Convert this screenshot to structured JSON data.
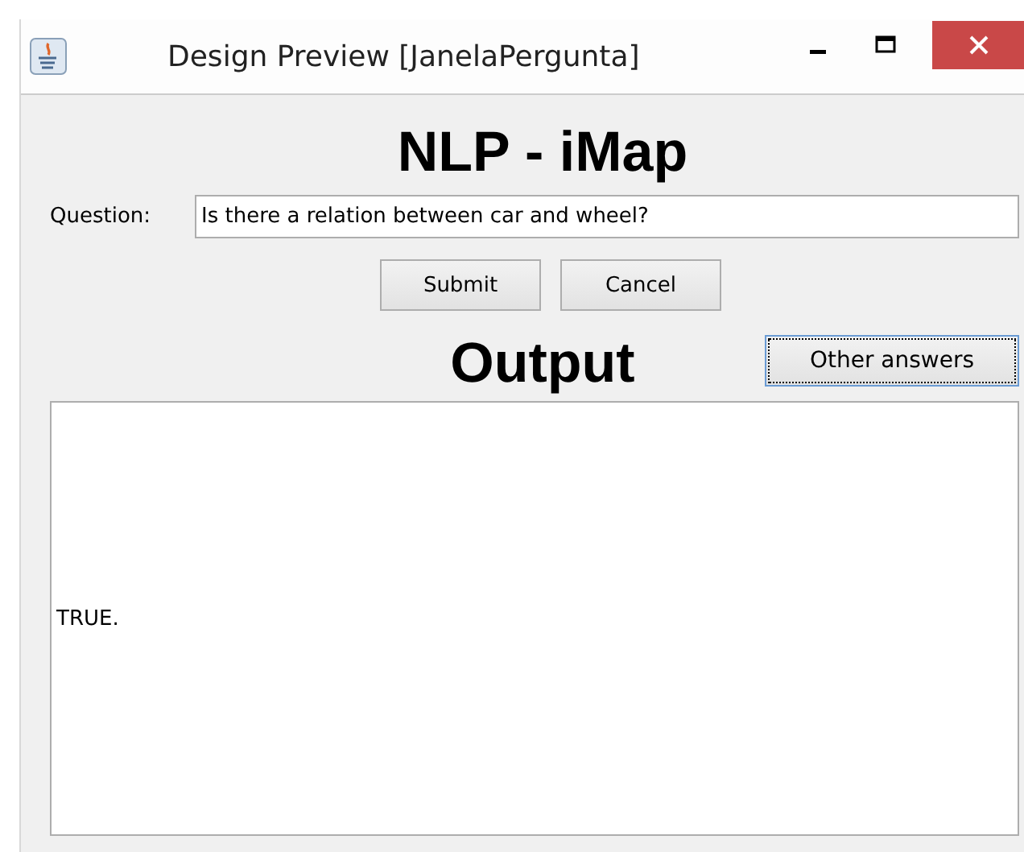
{
  "window": {
    "title": "Design Preview [JanelaPergunta]"
  },
  "heading": "NLP - iMap",
  "question": {
    "label": "Question:",
    "value": "Is there a relation between car and wheel?"
  },
  "buttons": [
    {
      "label": "Submit"
    },
    {
      "label": "Cancel"
    }
  ],
  "output_heading": "Output",
  "other_answers": {
    "label": "Other answers",
    "focused": true
  },
  "output": "TRUE."
}
